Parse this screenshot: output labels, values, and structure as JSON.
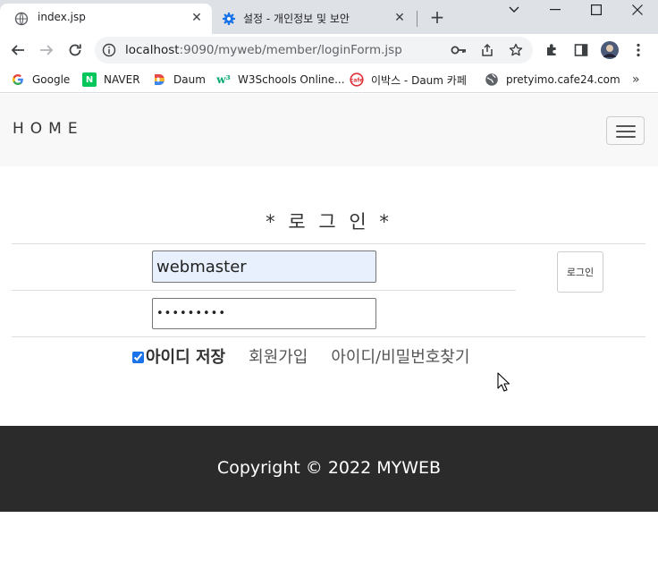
{
  "browser": {
    "tabs": [
      {
        "title": "index.jsp",
        "active": true,
        "icon": "globe-icon"
      },
      {
        "title": "설정 - 개인정보 및 보안",
        "active": false,
        "icon": "gear-icon"
      }
    ],
    "url_host": "localhost",
    "url_rest": ":9090/myweb/member/loginForm.jsp",
    "bookmarks": [
      {
        "label": "Google",
        "icon": "google-icon"
      },
      {
        "label": "NAVER",
        "icon": "naver-icon"
      },
      {
        "label": "Daum",
        "icon": "daum-icon"
      },
      {
        "label": "W3Schools Online...",
        "icon": "w3schools-icon"
      },
      {
        "label": "이박스 - Daum 카페",
        "icon": "daum-cafe-icon"
      },
      {
        "label": "pretyimo.cafe24.com",
        "icon": "globe-icon"
      }
    ],
    "colors": {
      "tabstrip": "#dee1e6",
      "omnibox": "#f1f3f4",
      "accent": "#1a73e8"
    }
  },
  "page": {
    "brand": "HOME",
    "login_title": "* 로 그 인 *",
    "id_value": "webmaster",
    "password_value": "•••••••••",
    "login_button": "로그인",
    "remember_checked": true,
    "remember_label": "아이디 저장",
    "join_link": "회원가입",
    "find_link": "아이디/비밀번호찾기",
    "footer": "Copyright © 2022 MYWEB",
    "colors": {
      "navbar": "#f8f8f8",
      "footer": "#2b2b2b",
      "id_autofill": "#e8f0fe"
    }
  }
}
